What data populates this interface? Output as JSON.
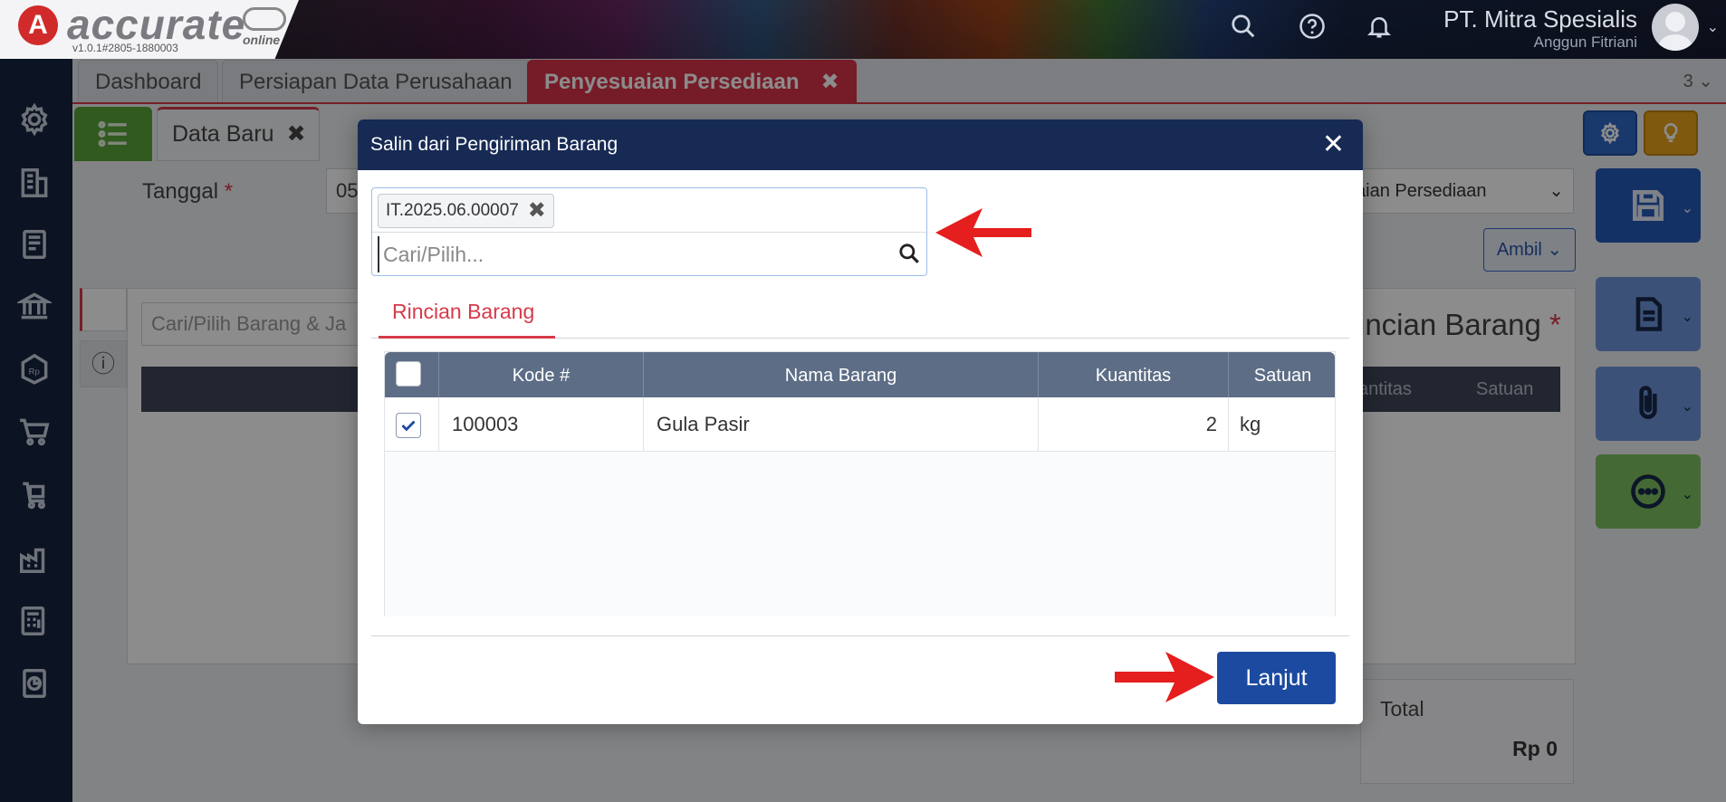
{
  "header": {
    "logo_letter": "A",
    "logo_text": "accurate",
    "logo_sub": "online",
    "version": "v1.0.1#2805-1880003",
    "company": "PT. Mitra Spesialis",
    "user": "Anggun Fitriani",
    "icons": [
      "search-icon",
      "help-icon",
      "bell-icon",
      "avatar"
    ]
  },
  "sidebar": {
    "icons": [
      "settings-icon",
      "building-icon",
      "book-icon",
      "bank-icon",
      "price-tag-icon",
      "cart-icon",
      "purchase-cart-icon",
      "factory-icon",
      "tax-calculator-icon",
      "report-icon"
    ]
  },
  "tabs": {
    "items": [
      {
        "label": "Dashboard"
      },
      {
        "label": "Persiapan Data Perusahaan"
      },
      {
        "label": "Penyesuaian Persediaan",
        "close": "✖"
      }
    ],
    "count": "3 ⌄"
  },
  "form": {
    "subtab_label": "Data Baru",
    "subtab_close": "✖",
    "tanggal_label": "Tanggal",
    "required_mark": "*",
    "date_value": "05",
    "select_value": "aian Persediaan",
    "ambil_label": "Ambil",
    "search_barang_placeholder": "Cari/Pilih Barang & Ja",
    "rincian_title": "incian Barang",
    "bg_col_kuantitas": "antitas",
    "bg_col_satuan": "Satuan",
    "total_label": "Total",
    "total_value": "Rp 0"
  },
  "modal": {
    "title": "Salin dari Pengiriman Barang",
    "close": "✕",
    "chip_value": "IT.2025.06.00007",
    "chip_close": "✖",
    "search_placeholder": "Cari/Pilih...",
    "tab_label": "Rincian Barang",
    "columns": {
      "kode": "Kode #",
      "nama": "Nama Barang",
      "kuantitas": "Kuantitas",
      "satuan": "Satuan"
    },
    "rows": [
      {
        "checked": true,
        "kode": "100003",
        "nama": "Gula Pasir",
        "kuantitas": "2",
        "satuan": "kg"
      }
    ],
    "next_button": "Lanjut"
  },
  "colors": {
    "accent_red": "#d63a4a",
    "navy": "#172a54",
    "primary_blue": "#1c4aa0",
    "arrow_red": "#e51e1e"
  }
}
